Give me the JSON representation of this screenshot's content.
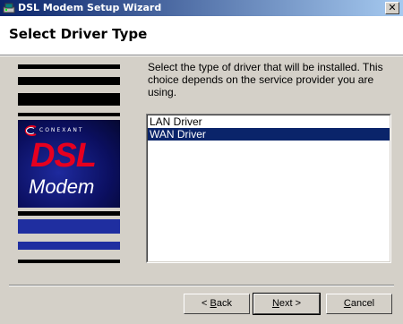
{
  "window": {
    "title": "DSL Modem Setup Wizard",
    "close_label": "✕"
  },
  "header": {
    "title": "Select Driver Type"
  },
  "logo": {
    "brand": "CONEXANT",
    "product_line1": "DSL",
    "product_line2": "Modem"
  },
  "main": {
    "description": "Select the type of driver that will be installed. This choice depends on the service provider you are using.",
    "driver_list": {
      "items": [
        {
          "label": "LAN Driver",
          "selected": false
        },
        {
          "label": "WAN Driver",
          "selected": true
        }
      ]
    }
  },
  "buttons": {
    "back": {
      "pre": "< ",
      "key": "B",
      "post": "ack"
    },
    "next": {
      "key": "N",
      "post": "ext >"
    },
    "cancel": {
      "key": "C",
      "post": "ancel"
    }
  },
  "colors": {
    "title_bar_start": "#0a246a",
    "title_bar_end": "#a6caf0",
    "selection": "#0a246a",
    "logo_red": "#e6001f",
    "logo_blue": "#1f2ea0"
  }
}
